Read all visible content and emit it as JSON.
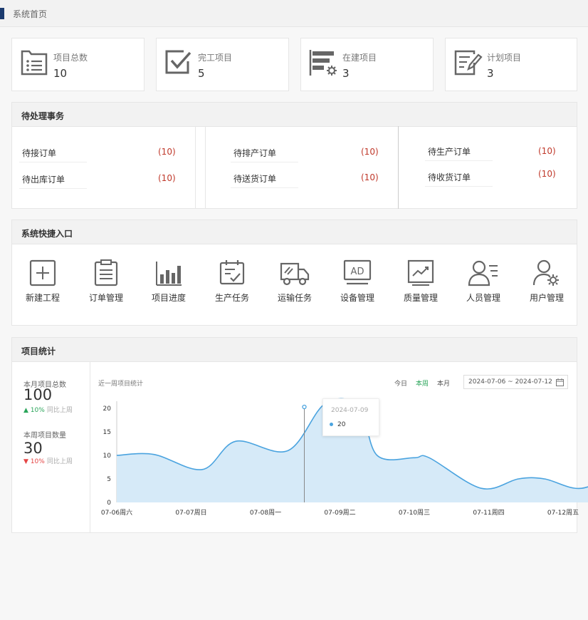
{
  "breadcrumb": "系统首页",
  "stats": [
    {
      "label": "项目总数",
      "value": "10",
      "icon": "list-icon"
    },
    {
      "label": "完工项目",
      "value": "5",
      "icon": "checkbox-icon"
    },
    {
      "label": "在建项目",
      "value": "3",
      "icon": "bars-gear-icon"
    },
    {
      "label": "计划项目",
      "value": "3",
      "icon": "edit-doc-icon"
    }
  ],
  "todo": {
    "title": "待处理事务",
    "items": [
      {
        "label": "待接订单",
        "count": "(10)"
      },
      {
        "label": "待出库订单",
        "count": "(10)"
      },
      {
        "label": "待排产订单",
        "count": "(10)"
      },
      {
        "label": "待送货订单",
        "count": "(10)"
      },
      {
        "label": "待生产订单",
        "count": "(10)"
      },
      {
        "label": "待收货订单",
        "count": "(10)"
      }
    ]
  },
  "quick": {
    "title": "系统快捷入口",
    "items": [
      {
        "label": "新建工程",
        "icon": "plus-square-icon"
      },
      {
        "label": "订单管理",
        "icon": "clipboard-icon"
      },
      {
        "label": "项目进度",
        "icon": "bar-chart-icon"
      },
      {
        "label": "生产任务",
        "icon": "calendar-check-icon"
      },
      {
        "label": "运输任务",
        "icon": "truck-icon"
      },
      {
        "label": "设备管理",
        "icon": "ad-monitor-icon"
      },
      {
        "label": "质量管理",
        "icon": "trend-board-icon"
      },
      {
        "label": "人员管理",
        "icon": "user-list-icon"
      },
      {
        "label": "用户管理",
        "icon": "user-gear-icon"
      }
    ]
  },
  "stats_panel": {
    "title": "项目统计",
    "month_total_label": "本月项目总数",
    "month_total_value": "100",
    "month_delta": "10%",
    "month_delta_dir": "up",
    "month_compare": "同比上周",
    "week_count_label": "本周项目数量",
    "week_count_value": "30",
    "week_delta": "10%",
    "week_delta_dir": "down",
    "week_compare": "同比上周",
    "chart_title": "近一周项目统计",
    "ranges": [
      "今日",
      "本周",
      "本月"
    ],
    "active_range": "本周",
    "date_range": "2024-07-06 ~ 2024-07-12",
    "tooltip": {
      "date": "2024-07-09",
      "value": "20"
    }
  },
  "colors": {
    "accent": "#2aa55a",
    "line": "#4aa3df",
    "fill": "#d6eaf8",
    "danger": "#c0392b",
    "brand": "#1b3b6f"
  },
  "chart_data": {
    "type": "area",
    "x": [
      "07-06周六",
      "07-07周日",
      "07-08周一",
      "07-09周二",
      "07-10周三",
      "07-11周四",
      "07-12周五"
    ],
    "ylim": [
      0,
      20
    ],
    "yticks": [
      0,
      5,
      10,
      15,
      20
    ],
    "series": [
      {
        "values": [
          10,
          10.2,
          7,
          13,
          11,
          21,
          20.5,
          10,
          9.5,
          9.5,
          3,
          5,
          5,
          3,
          7
        ]
      }
    ],
    "points_x_index": [
      0,
      0.5,
      1.15,
      1.6,
      2.3,
      2.8,
      3.25,
      3.5,
      4.0,
      4.2,
      4.9,
      5.4,
      5.75,
      6.25,
      6.8
    ]
  }
}
